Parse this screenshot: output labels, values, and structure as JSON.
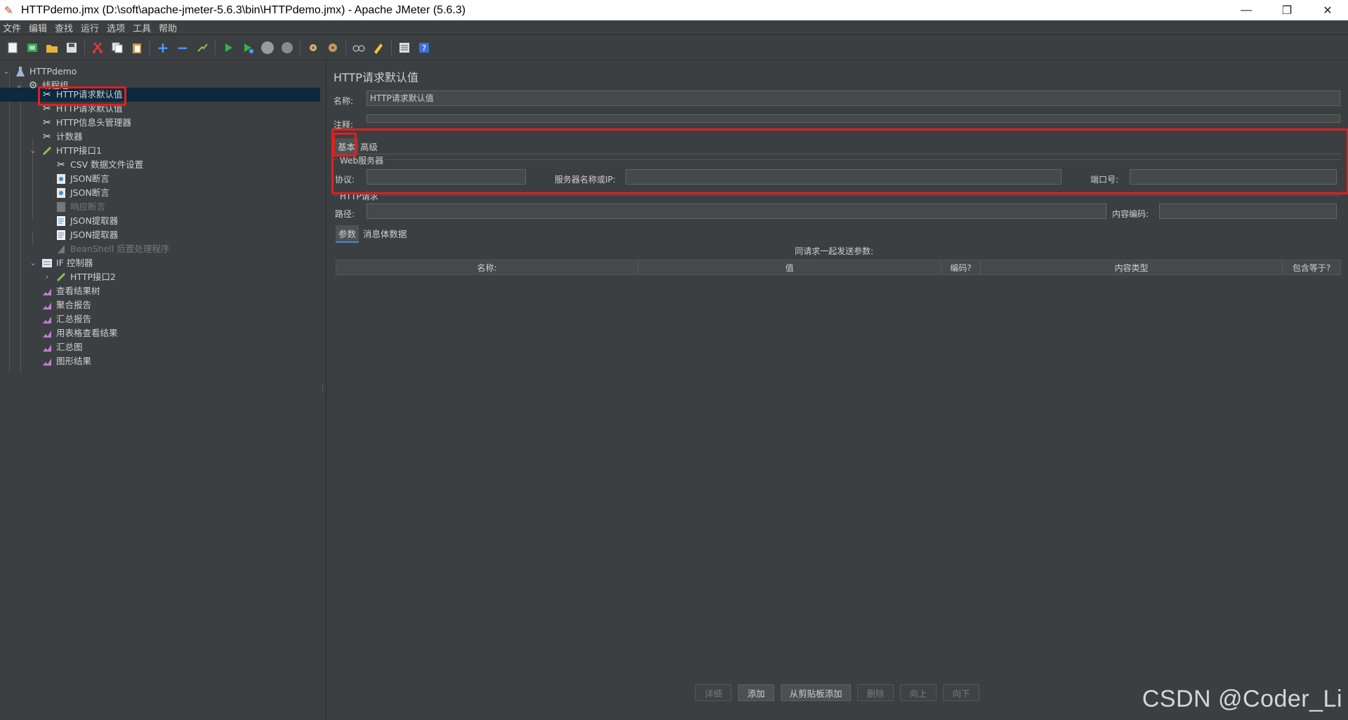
{
  "window": {
    "title": "HTTPdemo.jmx (D:\\soft\\apache-jmeter-5.6.3\\bin\\HTTPdemo.jmx) - Apache JMeter (5.6.3)",
    "minimize": "—",
    "maximize": "❐",
    "close": "✕"
  },
  "menu": [
    "文件",
    "编辑",
    "查找",
    "运行",
    "选项",
    "工具",
    "帮助"
  ],
  "toolbar_icons": [
    "new-icon",
    "template-icon",
    "open-icon",
    "save-icon",
    "cut-icon",
    "copy-icon",
    "paste-icon",
    "expand-icon",
    "collapse-icon",
    "toggle-icon",
    "start-icon",
    "start-no-pause-icon",
    "stop-icon",
    "shutdown-icon",
    "clear-icon",
    "clear-all-icon",
    "search-icon",
    "reset-search-icon",
    "function-helper-icon",
    "help-icon"
  ],
  "tree": {
    "items": [
      {
        "label": "HTTPdemo",
        "icon": "test-plan-icon"
      },
      {
        "label": "线程组",
        "icon": "gear-icon"
      },
      {
        "label": "HTTP请求默认值",
        "icon": "config-icon"
      },
      {
        "label": "HTTP请求默认值",
        "icon": "config-icon"
      },
      {
        "label": "HTTP信息头管理器",
        "icon": "config-icon"
      },
      {
        "label": "计数器",
        "icon": "config-icon"
      },
      {
        "label": "HTTP接口1",
        "icon": "sampler-icon"
      },
      {
        "label": "CSV 数据文件设置",
        "icon": "config-icon"
      },
      {
        "label": "JSON断言",
        "icon": "assertion-icon"
      },
      {
        "label": "JSON断言",
        "icon": "assertion-icon"
      },
      {
        "label": "响应断言",
        "icon": "assertion-icon"
      },
      {
        "label": "JSON提取器",
        "icon": "extractor-icon"
      },
      {
        "label": "JSON提取器",
        "icon": "extractor-icon"
      },
      {
        "label": "BeanShell 后置处理程序",
        "icon": "postprocessor-icon"
      },
      {
        "label": "IF 控制器",
        "icon": "controller-icon"
      },
      {
        "label": "HTTP接口2",
        "icon": "sampler-icon"
      },
      {
        "label": "查看结果树",
        "icon": "listener-icon"
      },
      {
        "label": "聚合报告",
        "icon": "listener-icon"
      },
      {
        "label": "汇总报告",
        "icon": "listener-icon"
      },
      {
        "label": "用表格查看结果",
        "icon": "listener-icon"
      },
      {
        "label": "汇总图",
        "icon": "listener-icon"
      },
      {
        "label": "图形结果",
        "icon": "listener-icon"
      }
    ]
  },
  "panel": {
    "title": "HTTP请求默认值",
    "name_label": "名称:",
    "name_value": "HTTP请求默认值",
    "comment_label": "注释:",
    "tabs": {
      "basic": "基本",
      "advanced": "高级"
    },
    "web_server_group": "Web服务器",
    "protocol_label": "协议:",
    "server_label": "服务器名称或IP:",
    "port_label": "端口号:",
    "http_request_group": "HTTP请求",
    "path_label": "路径:",
    "encoding_label": "内容编码:",
    "subtabs": {
      "params": "参数",
      "body": "消息体数据"
    },
    "send_params_label": "同请求一起发送参数:",
    "columns": [
      "名称:",
      "值",
      "编码?",
      "内容类型",
      "包含等于?"
    ]
  },
  "buttons": {
    "detail": "详细",
    "add": "添加",
    "add_clipboard": "从剪贴板添加",
    "delete": "删除",
    "up": "向上",
    "down": "向下"
  },
  "watermark": "CSDN @Coder_Li"
}
